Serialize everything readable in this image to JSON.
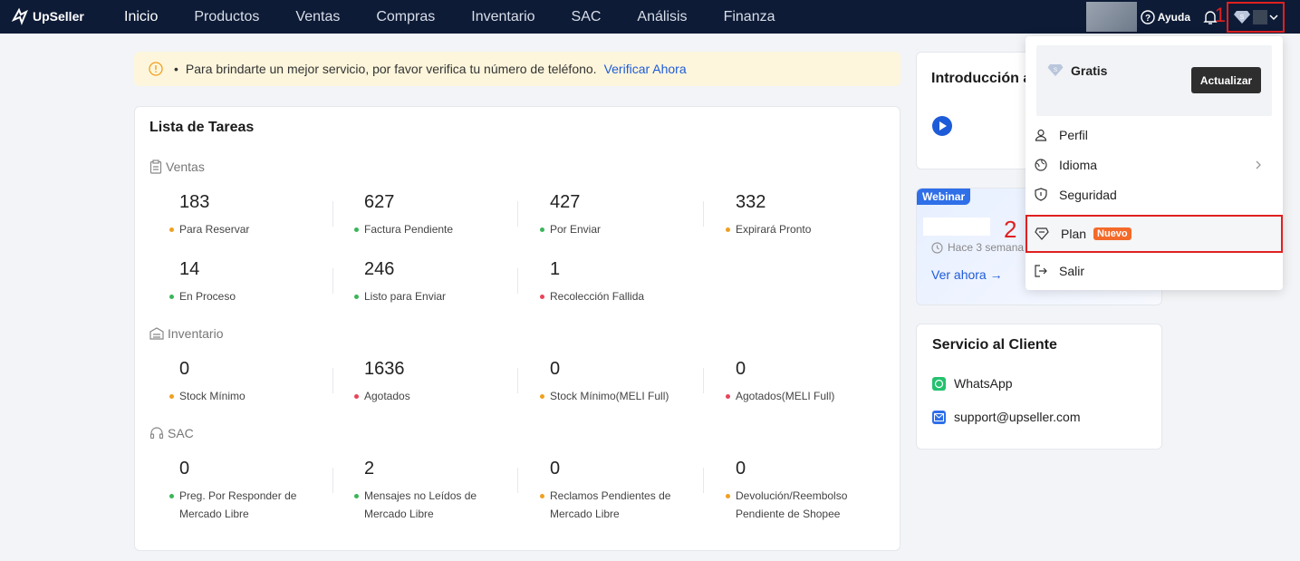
{
  "brand": {
    "name": "UpSeller"
  },
  "nav": {
    "items": [
      "Inicio",
      "Productos",
      "Ventas",
      "Compras",
      "Inventario",
      "SAC",
      "Análisis",
      "Finanza"
    ]
  },
  "topbar": {
    "help_label": "Ayuda"
  },
  "annotations": {
    "one": "1",
    "two": "2",
    "color": "#e02020"
  },
  "alert": {
    "bullet": "•",
    "text": "Para brindarte un mejor servicio, por favor verifica tu número de teléfono.",
    "link": "Verificar Ahora"
  },
  "tasks": {
    "title": "Lista de Tareas",
    "sections": {
      "ventas": {
        "title": "Ventas",
        "metrics": [
          {
            "value": "183",
            "label": "Para Reservar",
            "dot": "#f0a020"
          },
          {
            "value": "627",
            "label": "Factura Pendiente",
            "dot": "#3bb55a"
          },
          {
            "value": "427",
            "label": "Por Enviar",
            "dot": "#3bb55a"
          },
          {
            "value": "332",
            "label": "Expirará Pronto",
            "dot": "#f0a020"
          },
          {
            "value": "14",
            "label": "En Proceso",
            "dot": "#3bb55a"
          },
          {
            "value": "246",
            "label": "Listo para Enviar",
            "dot": "#3bb55a"
          },
          {
            "value": "1",
            "label": "Recolección Fallida",
            "dot": "#e8455a"
          }
        ]
      },
      "inventario": {
        "title": "Inventario",
        "metrics": [
          {
            "value": "0",
            "label": "Stock Mínimo",
            "dot": "#f0a020"
          },
          {
            "value": "1636",
            "label": "Agotados",
            "dot": "#e8455a"
          },
          {
            "value": "0",
            "label": "Stock Mínimo(MELI Full)",
            "dot": "#f0a020"
          },
          {
            "value": "0",
            "label": "Agotados(MELI Full)",
            "dot": "#e8455a"
          }
        ]
      },
      "sac": {
        "title": "SAC",
        "metrics": [
          {
            "value": "0",
            "label": "Preg. Por Responder de",
            "label2": "Mercado Libre",
            "dot": "#3bb55a"
          },
          {
            "value": "2",
            "label": "Mensajes no Leídos de",
            "label2": "Mercado Libre",
            "dot": "#3bb55a"
          },
          {
            "value": "0",
            "label": "Reclamos Pendientes de",
            "label2": "Mercado Libre",
            "dot": "#f0a020"
          },
          {
            "value": "0",
            "label": "Devolución/Reembolso",
            "label2": "Pendiente de Shopee",
            "dot": "#f0a020"
          }
        ]
      }
    }
  },
  "intro": {
    "title": "Introducción a"
  },
  "webinar": {
    "tag": "Webinar",
    "time": "Hace 3 semana",
    "link": "Ver ahora →"
  },
  "service": {
    "title": "Servicio al Cliente",
    "whatsapp": "WhatsApp",
    "email": "support@upseller.com"
  },
  "dropdown": {
    "plan_name": "Gratis",
    "upgrade": "Actualizar",
    "profile": "Perfil",
    "language": "Idioma",
    "security": "Seguridad",
    "plan": "Plan",
    "plan_badge": "Nuevo",
    "logout": "Salir"
  }
}
